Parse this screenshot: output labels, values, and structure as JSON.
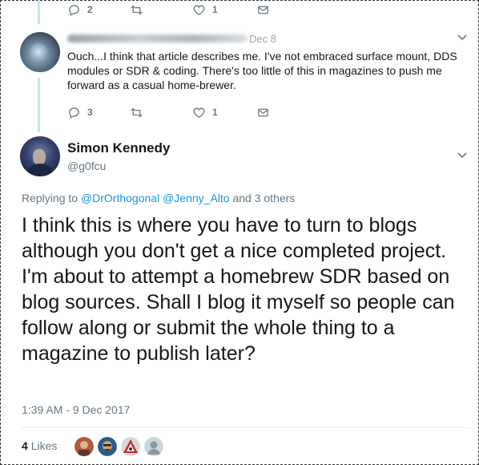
{
  "top_actions": {
    "reply_count": "2",
    "retweet_count": "",
    "like_count": "1"
  },
  "reply_tweet": {
    "date": "Dec 8",
    "text": "Ouch...I think that article describes me. I've not embraced surface mount, DDS modules or SDR & coding. There's too little of this in magazines to push me forward as a casual home-brewer.",
    "actions": {
      "reply_count": "3",
      "retweet_count": "",
      "like_count": "1"
    }
  },
  "main_tweet": {
    "display_name": "Simon Kennedy",
    "handle": "@g0fcu",
    "replying_prefix": "Replying to ",
    "mention_1": "@DrOrthogonal",
    "mention_2": "@Jenny_Alto",
    "replying_suffix": " and 3 others",
    "text": "I think this is where you have to turn to blogs although you don't get a nice completed project. I'm about to attempt a homebrew SDR based on blog sources. Shall I blog it myself so people can follow along or submit the whole thing to a magazine to publish later?",
    "timestamp": "1:39 AM - 9 Dec 2017",
    "likes_count": "4",
    "likes_label": "Likes"
  },
  "icons": [
    "reply-icon",
    "retweet-icon",
    "like-icon",
    "direct-message-icon",
    "chevron-down-icon"
  ],
  "colors": {
    "accent": "#1b95e0",
    "muted": "#657786",
    "thread_line": "#c4e3f6",
    "text": "#14171a"
  }
}
